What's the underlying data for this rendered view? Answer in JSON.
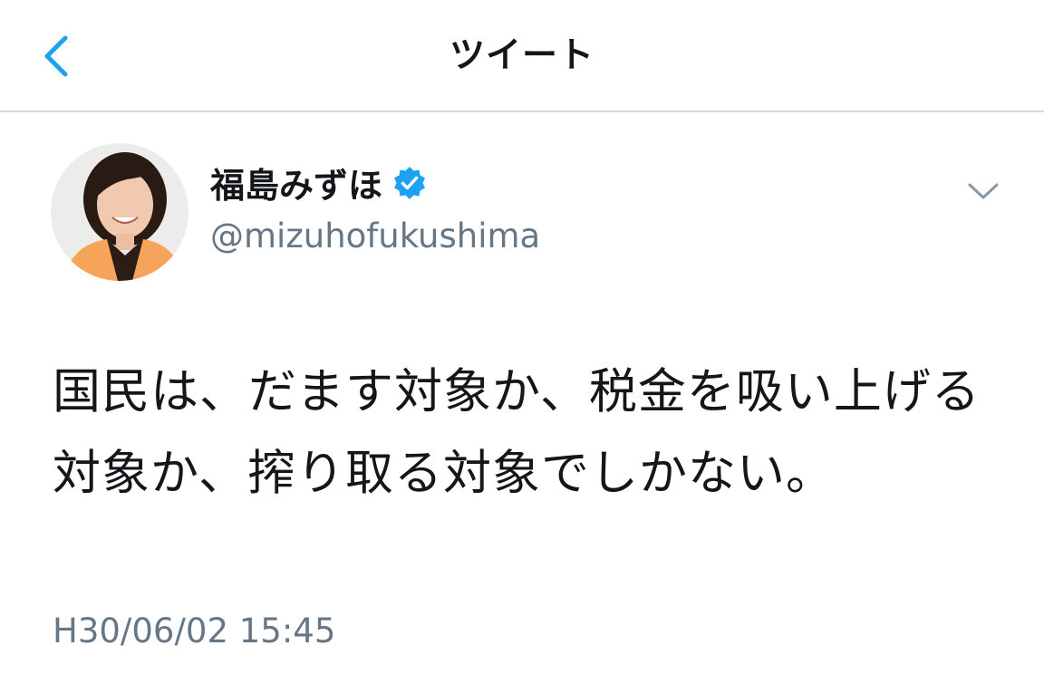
{
  "header": {
    "title": "ツイート",
    "back_icon": "chevron-left-icon",
    "accent_color": "#1da1f2"
  },
  "tweet": {
    "author": {
      "display_name": "福島みずほ",
      "handle": "@mizuhofukushima",
      "verified": true,
      "verified_icon": "verified-badge-icon"
    },
    "menu_icon": "chevron-down-icon",
    "text": "国民は、だます対象か、税金を吸い上げる対象か、搾り取る対象でしかない。",
    "timestamp": "H30/06/02 15:45"
  }
}
